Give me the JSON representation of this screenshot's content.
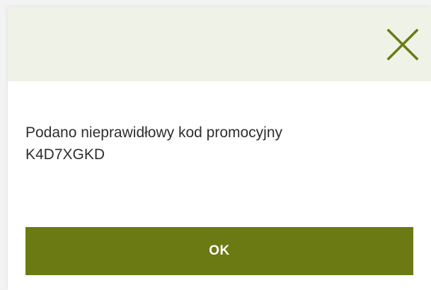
{
  "dialog": {
    "message": "Podano nieprawidłowy kod promocyjny\nK4D7XGKD",
    "ok_label": "OK",
    "close_icon": "close-icon"
  },
  "colors": {
    "accent": "#6b7a12",
    "header_background": "#eff2e6",
    "close_icon": "#6b7a12"
  }
}
